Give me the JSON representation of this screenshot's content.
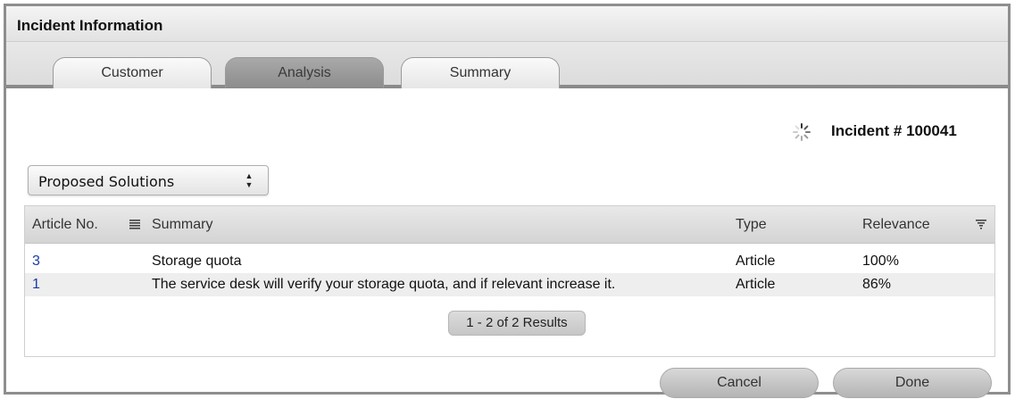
{
  "window": {
    "title": "Incident Information"
  },
  "tabs": [
    {
      "label": "Customer",
      "active": false
    },
    {
      "label": "Analysis",
      "active": true
    },
    {
      "label": "Summary",
      "active": false
    }
  ],
  "incident": {
    "label": "Incident # 100041"
  },
  "view_select": {
    "selected": "Proposed Solutions"
  },
  "table": {
    "columns": [
      "Article No.",
      "Summary",
      "Type",
      "Relevance"
    ],
    "rows": [
      {
        "article_no": "3",
        "summary": "Storage quota",
        "type": "Article",
        "relevance": "100%"
      },
      {
        "article_no": "1",
        "summary": "The service desk will verify your storage quota, and if relevant increase it.",
        "type": "Article",
        "relevance": "86%"
      }
    ],
    "pager": "1 - 2 of 2 Results"
  },
  "buttons": {
    "cancel": "Cancel",
    "done": "Done"
  },
  "colors": {
    "link": "#1a3ca8",
    "active_tab": "#8c8c8c"
  },
  "icons": {
    "spinner": "loading-spinner-icon",
    "column_menu": "column-menu-icon",
    "filter": "filter-icon"
  }
}
